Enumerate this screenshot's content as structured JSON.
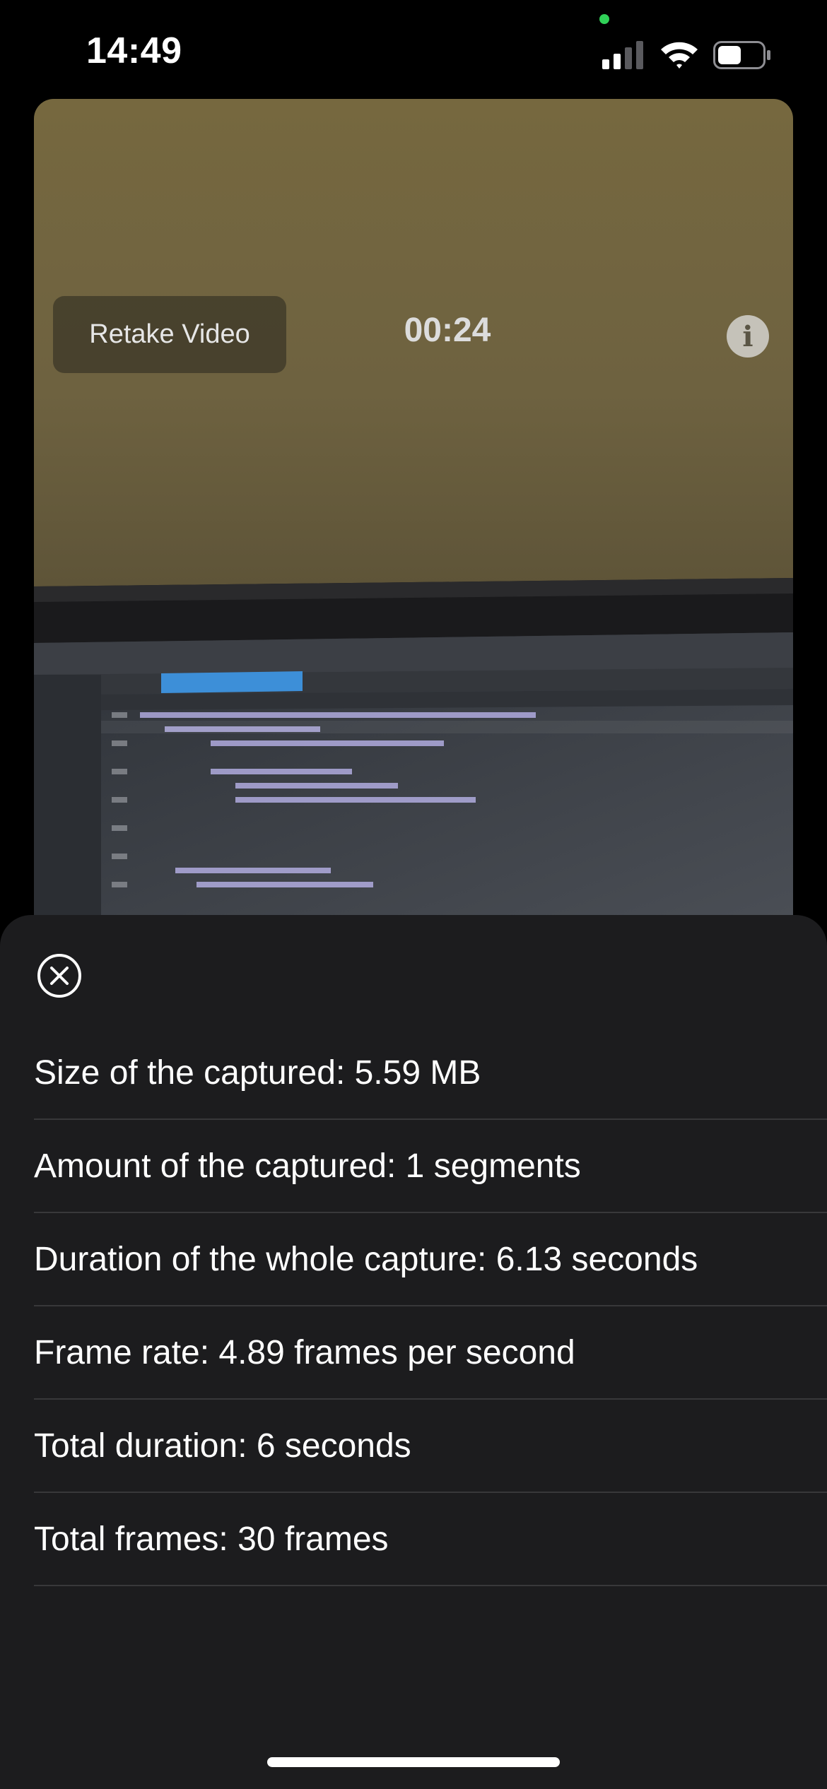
{
  "status_bar": {
    "time": "14:49",
    "icons": [
      "privacy-indicator-dot",
      "cellular-signal-icon",
      "wifi-icon",
      "battery-icon"
    ]
  },
  "camera": {
    "retake_label": "Retake Video",
    "timer": "00:24",
    "info_icon": "info-icon",
    "info_glyph": "i"
  },
  "sheet": {
    "close_icon": "close-circle-icon",
    "rows": [
      "Size of the captured: 5.59 MB",
      "Amount of the captured: 1 segments",
      "Duration of the whole capture: 6.13 seconds",
      "Frame rate: 4.89 frames per second",
      "Total duration: 6 seconds",
      "Total frames: 30 frames"
    ]
  },
  "colors": {
    "sheet_background": "#1c1c1e",
    "separator": "#38383a",
    "privacy_dot": "#30d158",
    "wall": "#7a6a45"
  }
}
